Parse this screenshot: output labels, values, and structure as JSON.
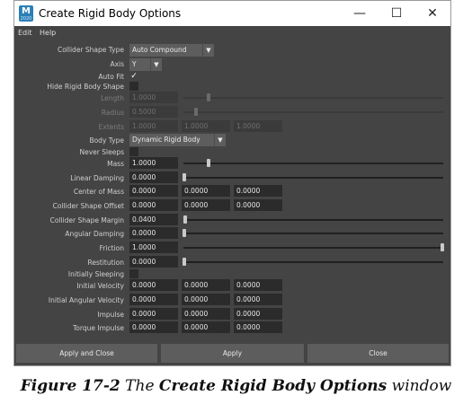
{
  "window": {
    "app_icon_letter": "M",
    "app_icon_sub": "2020",
    "title": "Create Rigid Body Options",
    "minimize_glyph": "—",
    "maximize_glyph": "☐",
    "close_glyph": "✕"
  },
  "menu": [
    "Edit",
    "Help"
  ],
  "fields": {
    "collider_shape_type": {
      "label": "Collider Shape Type",
      "value": "Auto Compound"
    },
    "axis": {
      "label": "Axis",
      "value": "Y"
    },
    "auto_fit": {
      "label": "Auto Fit",
      "checked": true,
      "mark": "✓"
    },
    "hide_rigid_body_shape": {
      "label": "Hide Rigid Body Shape",
      "checked": false
    },
    "length": {
      "label": "Length",
      "value": "1.0000",
      "slider": 0.25
    },
    "radius": {
      "label": "Radius",
      "value": "0.5000",
      "slider": 0.2
    },
    "extents": {
      "label": "Extents",
      "values": [
        "1.0000",
        "1.0000",
        "1.0000"
      ]
    },
    "body_type": {
      "label": "Body Type",
      "value": "Dynamic Rigid Body"
    },
    "never_sleeps": {
      "label": "Never Sleeps",
      "checked": false
    },
    "mass": {
      "label": "Mass",
      "value": "1.0000",
      "slider": 0.1
    },
    "linear_damping": {
      "label": "Linear Damping",
      "value": "0.0000",
      "slider": 0.0
    },
    "center_of_mass": {
      "label": "Center of Mass",
      "values": [
        "0.0000",
        "0.0000",
        "0.0000"
      ]
    },
    "collider_shape_offset": {
      "label": "Collider Shape Offset",
      "values": [
        "0.0000",
        "0.0000",
        "0.0000"
      ]
    },
    "collider_shape_margin": {
      "label": "Collider Shape Margin",
      "value": "0.0400",
      "slider": 0.01
    },
    "angular_damping": {
      "label": "Angular Damping",
      "value": "0.0000",
      "slider": 0.0
    },
    "friction": {
      "label": "Friction",
      "value": "1.0000",
      "slider": 1.0
    },
    "restitution": {
      "label": "Restitution",
      "value": "0.0000",
      "slider": 0.0
    },
    "initially_sleeping": {
      "label": "Initially Sleeping",
      "checked": false
    },
    "initial_velocity": {
      "label": "Initial Velocity",
      "values": [
        "0.0000",
        "0.0000",
        "0.0000"
      ]
    },
    "initial_angular_velocity": {
      "label": "Initial Angular Velocity",
      "values": [
        "0.0000",
        "0.0000",
        "0.0000"
      ]
    },
    "impulse": {
      "label": "Impulse",
      "values": [
        "0.0000",
        "0.0000",
        "0.0000"
      ]
    },
    "torque_impulse": {
      "label": "Torque Impulse",
      "values": [
        "0.0000",
        "0.0000",
        "0.0000"
      ]
    }
  },
  "buttons": {
    "apply_and_close": "Apply and Close",
    "apply": "Apply",
    "close": "Close"
  },
  "caption": {
    "figure": "Figure 17-2",
    "prefix": "The",
    "bold": "Create Rigid Body Options",
    "suffix": "window"
  },
  "colors": {
    "panel": "#444444",
    "field": "#2b2b2b",
    "button": "#5d5d5d",
    "label": "#cfcfcf"
  }
}
